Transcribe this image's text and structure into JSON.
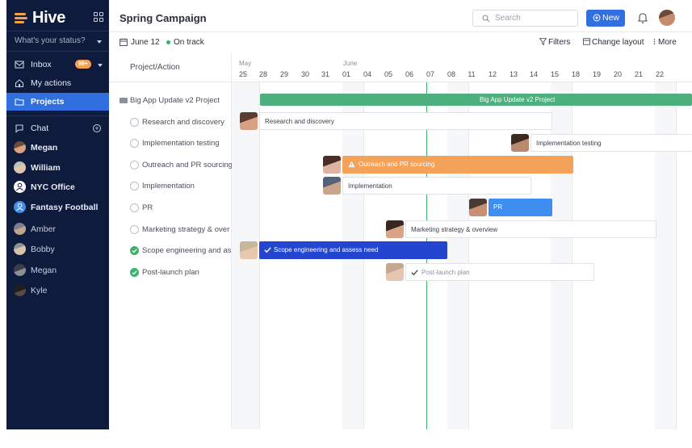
{
  "app": {
    "logo": "Hive",
    "logo_icon": "hive-logo-icon",
    "apps_icon": "grid-icon"
  },
  "sidebar": {
    "status_placeholder": "What's your status?",
    "inbox": {
      "label": "Inbox",
      "badge": "99+"
    },
    "my_actions": "My actions",
    "projects": "Projects",
    "chat": "Chat",
    "contacts": [
      {
        "name": "Megan",
        "bold": true
      },
      {
        "name": "William",
        "bold": true
      },
      {
        "name": "NYC Office",
        "bold": true
      },
      {
        "name": "Fantasy Football",
        "bold": true
      },
      {
        "name": "Amber",
        "bold": false
      },
      {
        "name": "Bobby",
        "bold": false
      },
      {
        "name": "Megan",
        "bold": false
      },
      {
        "name": "Kyle",
        "bold": false
      }
    ]
  },
  "header": {
    "title": "Spring Campaign",
    "search_placeholder": "Search",
    "new_label": "New"
  },
  "subbar": {
    "date": "June 12",
    "status": "On track",
    "status_color": "#3bb36b",
    "filters": "Filters",
    "change_layout": "Change layout",
    "more": "More"
  },
  "gantt": {
    "column_header": "Project/Action",
    "months": [
      "May",
      "June"
    ],
    "days": [
      "25",
      "28",
      "29",
      "30",
      "31",
      "01",
      "04",
      "05",
      "06",
      "07",
      "08",
      "11",
      "12",
      "13",
      "14",
      "15",
      "18",
      "19",
      "20",
      "21",
      "22"
    ],
    "project": "Big App Update v2 Project",
    "actions": [
      {
        "label": "Research and discovery",
        "bar": "Research and discovery",
        "done": false
      },
      {
        "label": "Implementation testing",
        "bar": "Implementation testing",
        "done": false
      },
      {
        "label": "Outreach and PR sourcing",
        "bar": "Outreach and PR sourcing",
        "done": false
      },
      {
        "label": "Implementation",
        "bar": "Implementation",
        "done": false
      },
      {
        "label": "PR",
        "bar": "PR",
        "done": false
      },
      {
        "label": "Marketing strategy & over",
        "bar": "Marketing strategy & overview",
        "done": false
      },
      {
        "label": "Scope engineering and as",
        "bar": "Scope engineering and assess need",
        "done": true
      },
      {
        "label": "Post-launch plan",
        "bar": "Post-launch plan",
        "done": true
      }
    ],
    "colors": {
      "project": "#4caf7d",
      "warning": "#f4a25a",
      "blue": "#3d8ef0",
      "navy": "#2345cf",
      "today": "#3bb36b"
    }
  }
}
